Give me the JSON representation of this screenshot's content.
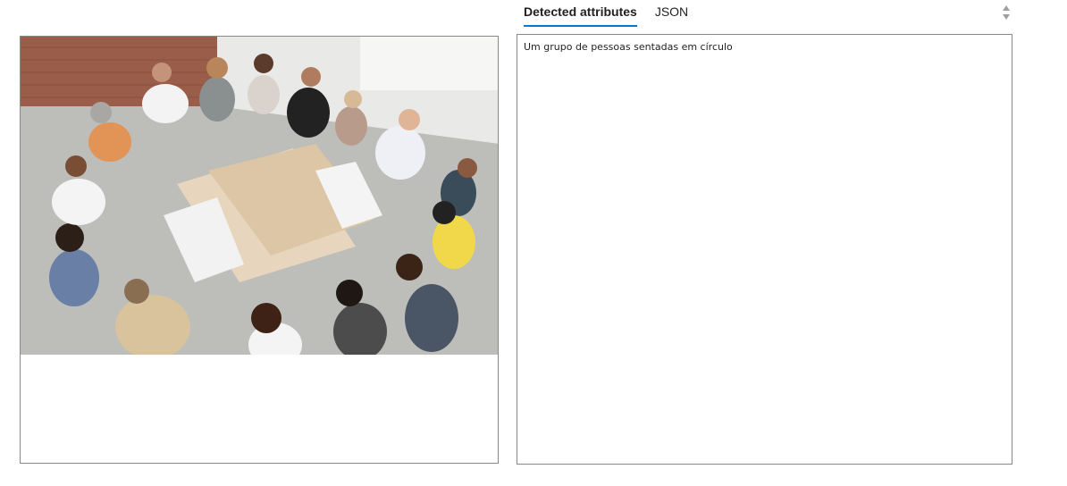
{
  "image_panel": {
    "image_alt": "Um grupo de pessoas sentadas em círculo"
  },
  "tabs": [
    {
      "label": "Detected attributes",
      "selected": true
    },
    {
      "label": "JSON",
      "selected": false
    }
  ],
  "result": {
    "text": "Um grupo de pessoas sentadas em círculo"
  },
  "colors": {
    "accent": "#0078d4",
    "border": "#8a8886"
  },
  "icons": {
    "scroll_control": "sort-arrows-icon"
  }
}
